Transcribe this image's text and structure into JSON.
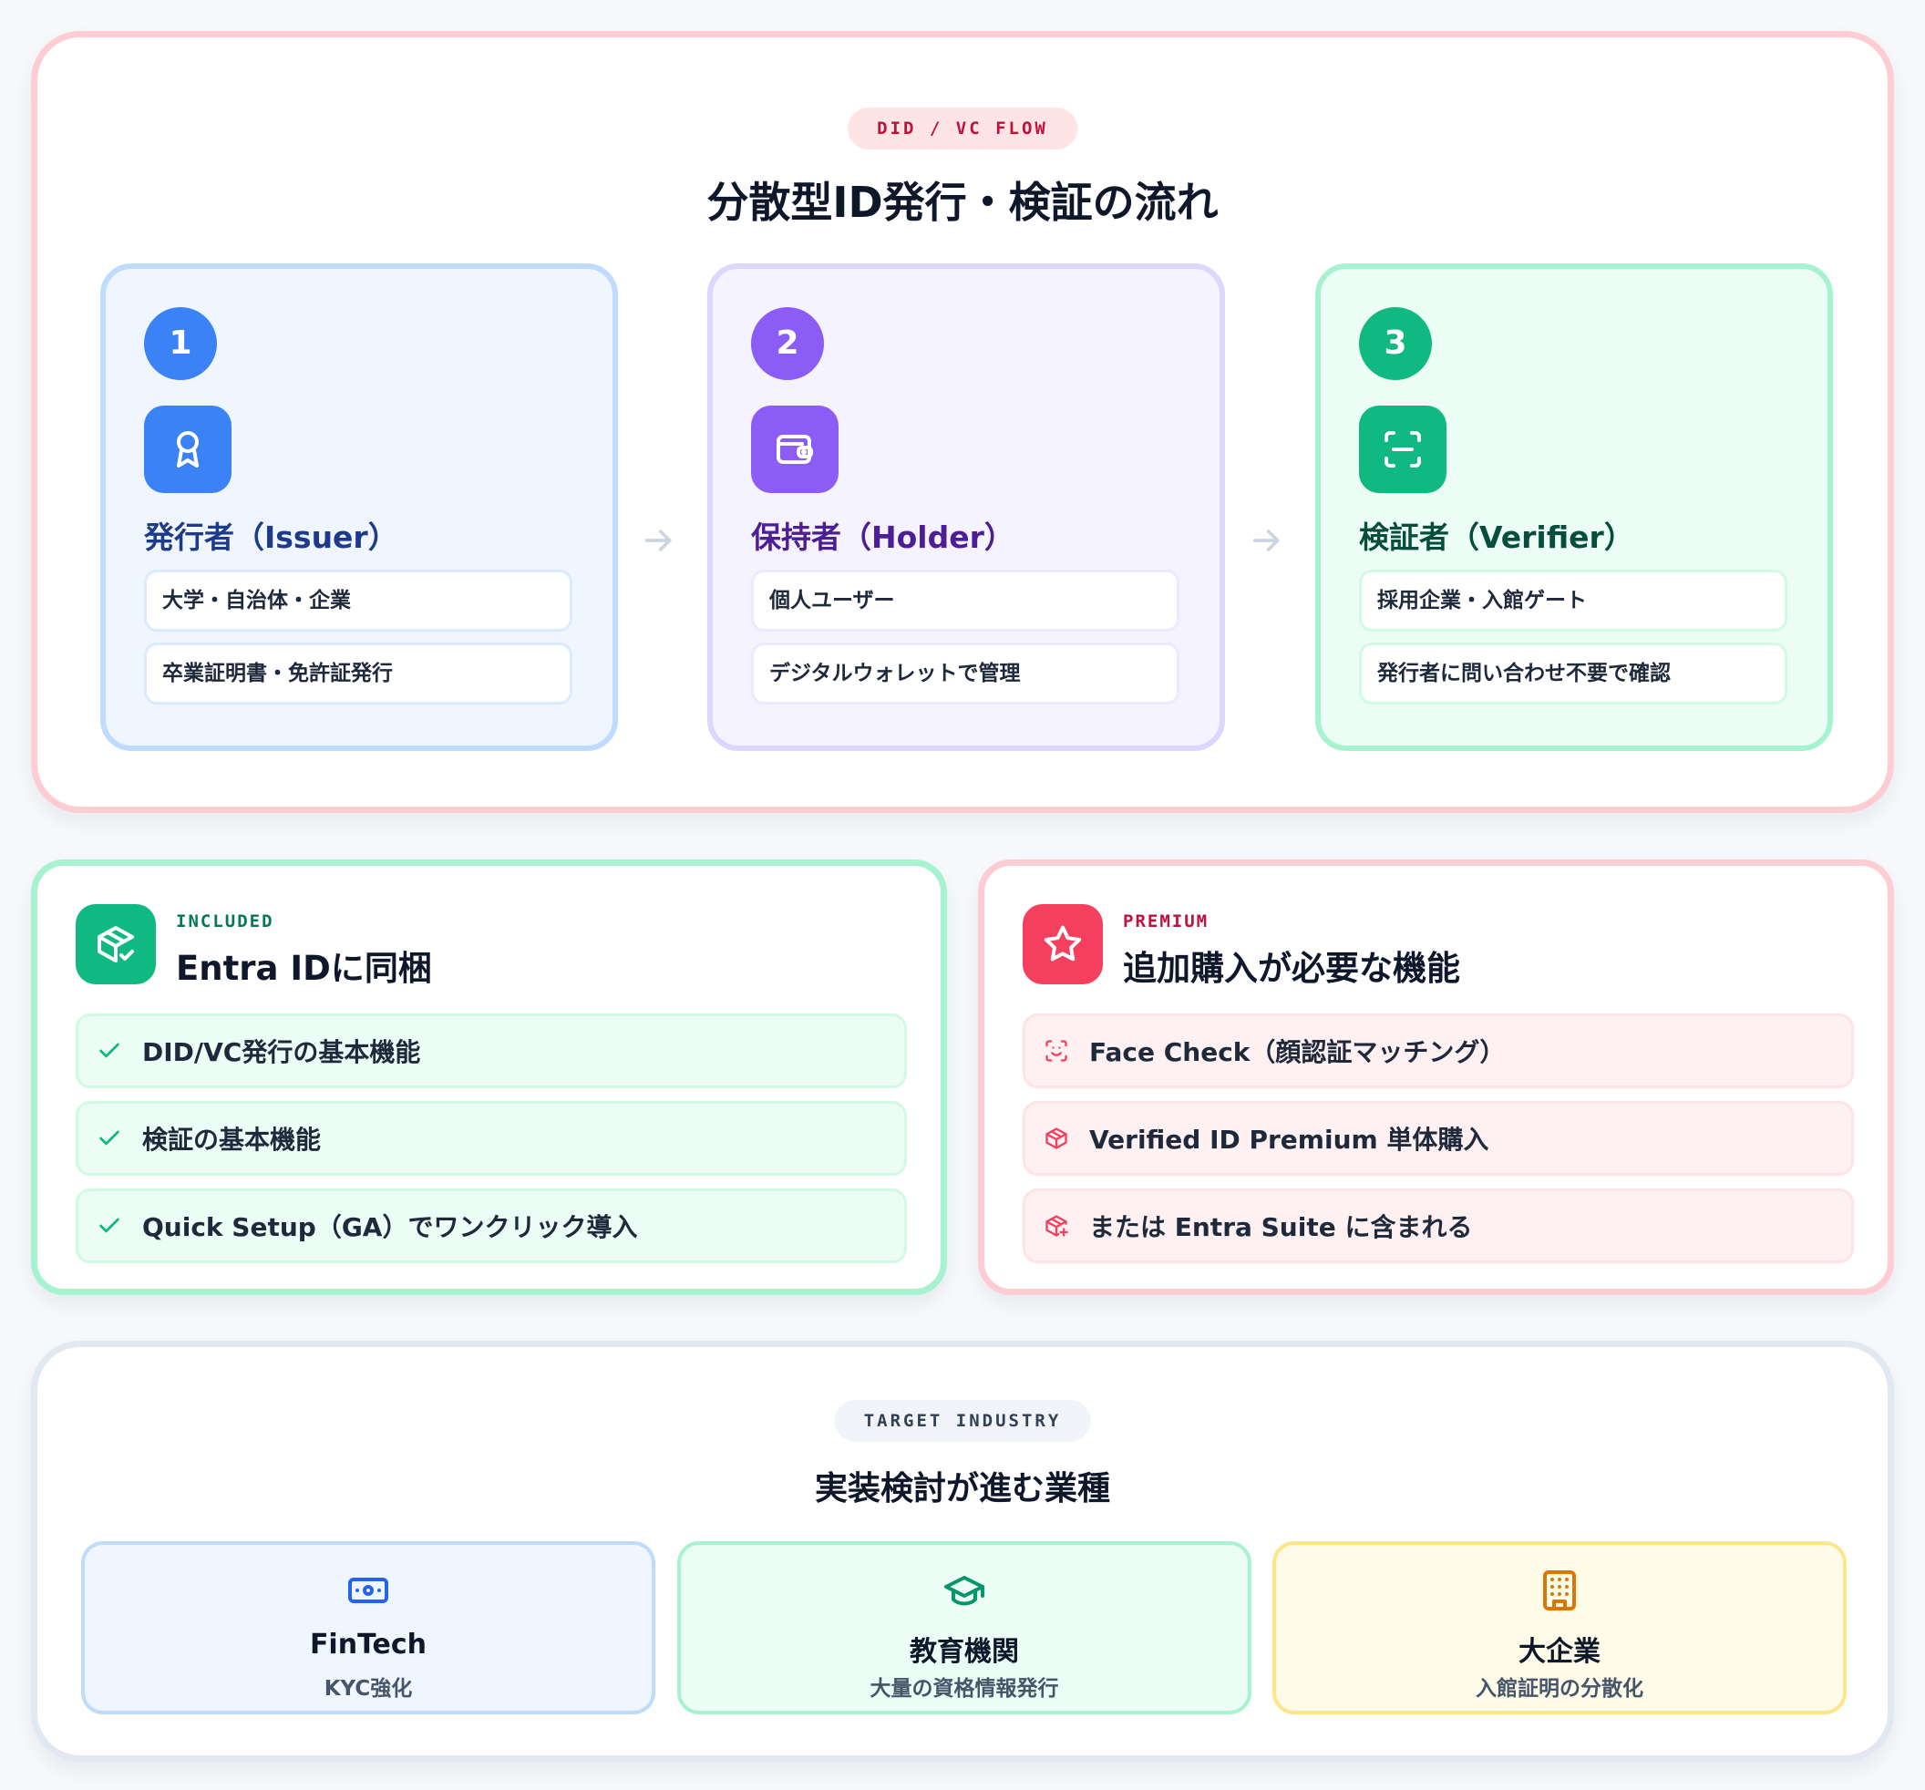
{
  "flow": {
    "badge": "DID / VC FLOW",
    "title": "分散型ID発行・検証の流れ",
    "steps": [
      {
        "number": "1",
        "icon": "award-icon",
        "name": "発行者（Issuer）",
        "items": [
          "大学・自治体・企業",
          "卒業証明書・免許証発行"
        ]
      },
      {
        "number": "2",
        "icon": "wallet-icon",
        "name": "保持者（Holder）",
        "items": [
          "個人ユーザー",
          "デジタルウォレットで管理"
        ]
      },
      {
        "number": "3",
        "icon": "scan-icon",
        "name": "検証者（Verifier）",
        "items": [
          "採用企業・入館ゲート",
          "発行者に問い合わせ不要で確認"
        ]
      }
    ]
  },
  "included": {
    "kicker": "INCLUDED",
    "title": "Entra IDに同梱",
    "icon": "package-check-icon",
    "items": [
      {
        "icon": "check-icon",
        "label": "DID/VC発行の基本機能"
      },
      {
        "icon": "check-icon",
        "label": "検証の基本機能"
      },
      {
        "icon": "check-icon",
        "label": "Quick Setup（GA）でワンクリック導入"
      }
    ]
  },
  "premium": {
    "kicker": "PREMIUM",
    "title": "追加購入が必要な機能",
    "icon": "star-icon",
    "items": [
      {
        "icon": "face-scan-icon",
        "label": "Face Check（顔認証マッチング）"
      },
      {
        "icon": "box-icon",
        "label": "Verified ID Premium 単体購入"
      },
      {
        "icon": "box-plus-icon",
        "label": "または Entra Suite に含まれる"
      }
    ]
  },
  "industry": {
    "badge": "TARGET INDUSTRY",
    "title": "実装検討が進む業種",
    "items": [
      {
        "icon": "banknote-icon",
        "name": "FinTech",
        "desc": "KYC強化"
      },
      {
        "icon": "graduation-cap-icon",
        "name": "教育機関",
        "desc": "大量の資格情報発行"
      },
      {
        "icon": "building-icon",
        "name": "大企業",
        "desc": "入館証明の分散化"
      }
    ]
  },
  "colors": {
    "issuer": "#3b82f6",
    "holder": "#8b5cf6",
    "verifier": "#10b981",
    "included": "#10b981",
    "premium": "#f43f5e",
    "fintech": "#2563eb",
    "education": "#059669",
    "enterprise": "#d97706"
  }
}
